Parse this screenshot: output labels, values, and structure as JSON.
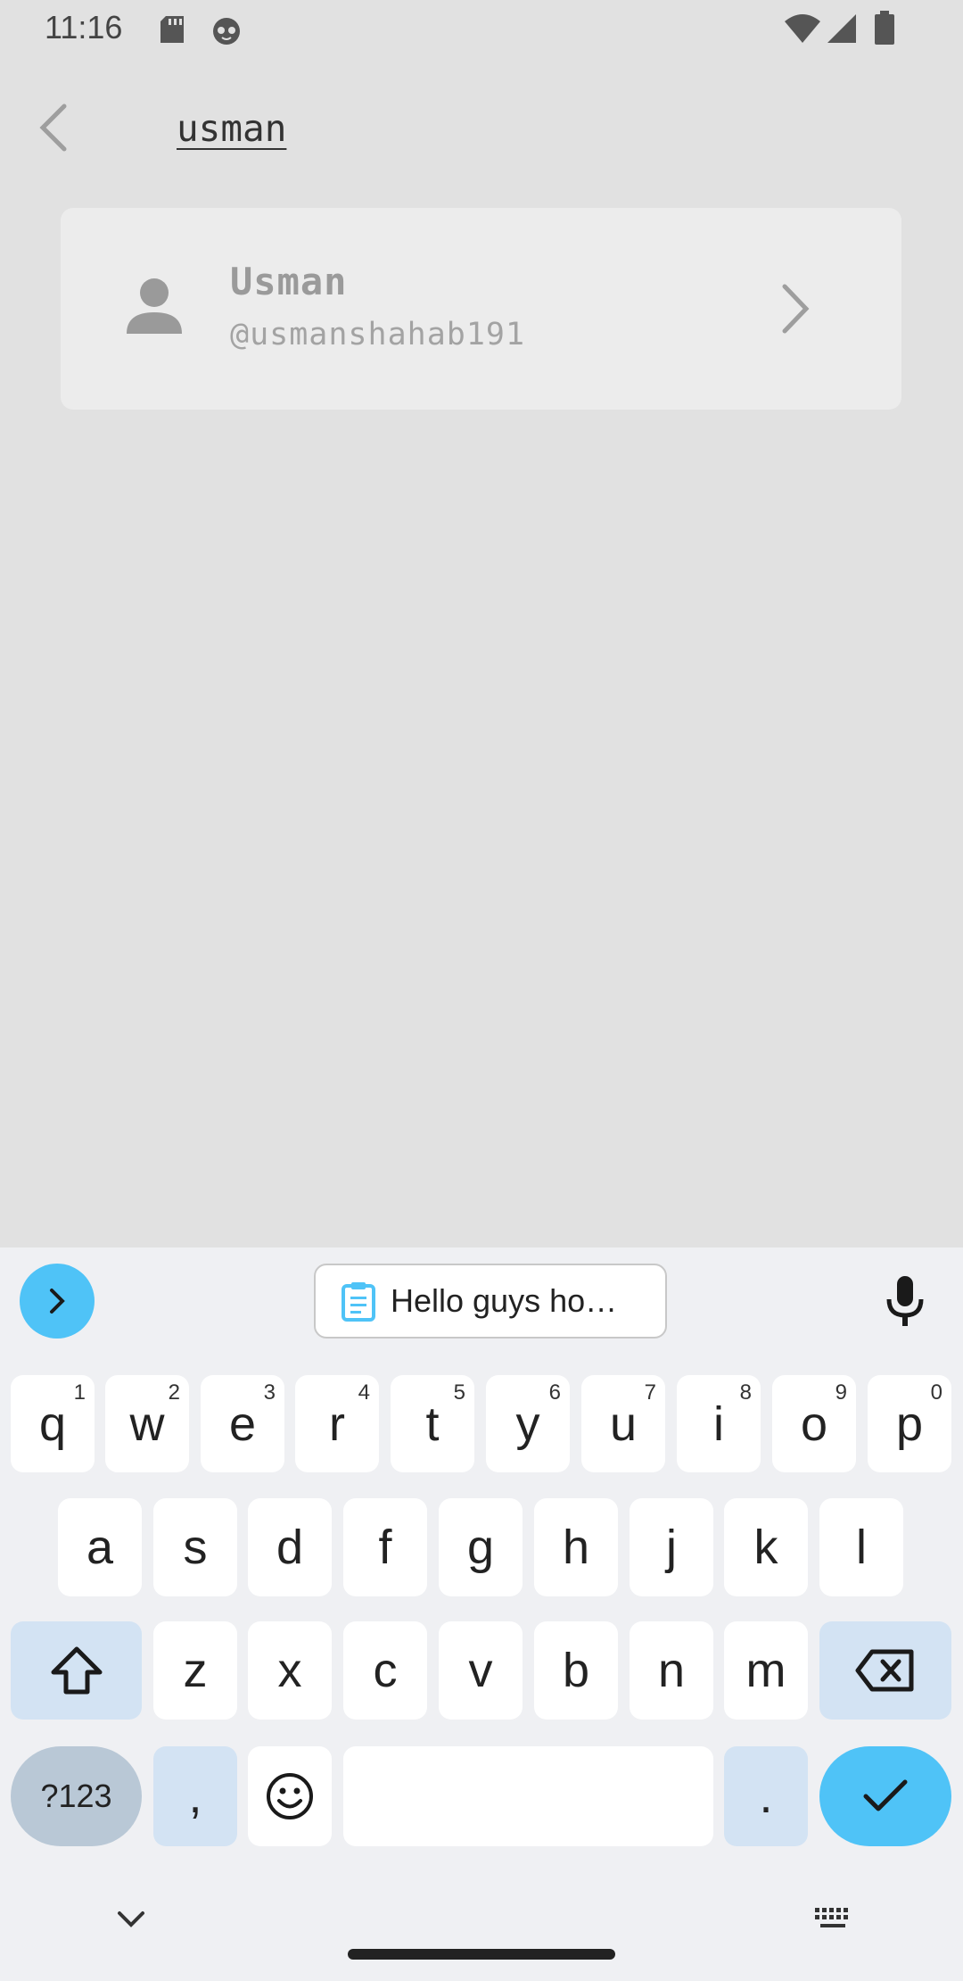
{
  "status_bar": {
    "time": "11:16",
    "icons": [
      "sd-card-icon",
      "cat-face-icon",
      "wifi-icon",
      "signal-icon",
      "battery-icon"
    ]
  },
  "search": {
    "query": "usman"
  },
  "results": [
    {
      "name": "Usman",
      "handle": "@usmanshahab191"
    }
  ],
  "keyboard": {
    "clipboard_suggestion": "Hello guys ho…",
    "row1": [
      {
        "label": "q",
        "hint": "1"
      },
      {
        "label": "w",
        "hint": "2"
      },
      {
        "label": "e",
        "hint": "3"
      },
      {
        "label": "r",
        "hint": "4"
      },
      {
        "label": "t",
        "hint": "5"
      },
      {
        "label": "y",
        "hint": "6"
      },
      {
        "label": "u",
        "hint": "7"
      },
      {
        "label": "i",
        "hint": "8"
      },
      {
        "label": "o",
        "hint": "9"
      },
      {
        "label": "p",
        "hint": "0"
      }
    ],
    "row2": [
      "a",
      "s",
      "d",
      "f",
      "g",
      "h",
      "j",
      "k",
      "l"
    ],
    "row3": [
      "z",
      "x",
      "c",
      "v",
      "b",
      "n",
      "m"
    ],
    "symbols_label": "?123",
    "comma_label": ",",
    "period_label": ".",
    "colors": {
      "accent": "#4fc3f7",
      "function_key": "#d3e3f3"
    }
  }
}
